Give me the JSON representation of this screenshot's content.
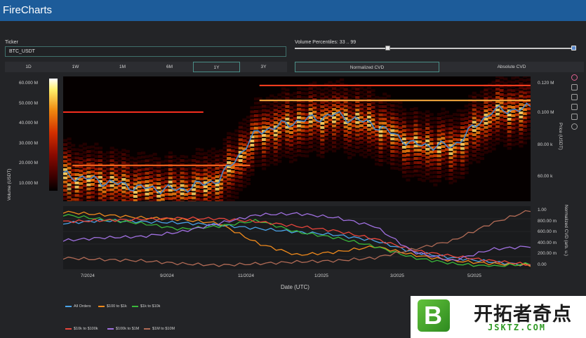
{
  "app": {
    "title": "FireCharts"
  },
  "ticker": {
    "label": "Ticker",
    "value": "BTC_USDT"
  },
  "volume_percentiles": {
    "label": "Volume Percentiles: 33 .. 99",
    "low": 33,
    "high": 99
  },
  "timeframes": {
    "items": [
      "1D",
      "1W",
      "1M",
      "6M",
      "1Y",
      "3Y"
    ],
    "active": "1Y"
  },
  "cvd_modes": {
    "items": [
      "Normalized CVD",
      "Absolute CVD"
    ],
    "active": "Normalized CVD"
  },
  "colors": {
    "topbar": "#1d5c9a",
    "accent_border": "#4a8d86",
    "price_line": "#4a86c8"
  },
  "heatmap": {
    "left_axis_title": "Volume (USDT)",
    "left_ticks": [
      "60.000 M",
      "50.000 M",
      "40.000 M",
      "30.000 M",
      "20.000 M",
      "10.000 M"
    ],
    "right_axis_title": "Price (USDT)",
    "right_ticks": [
      "0.120 M",
      "0.100 M",
      "80.00 k",
      "60.00 k"
    ]
  },
  "cvd": {
    "right_axis_title": "Normalized CVD (arb. u.)",
    "right_ticks": [
      "1.00",
      "800.00 m",
      "600.00 m",
      "400.00 m",
      "200.00 m",
      "0.00"
    ]
  },
  "x_axis": {
    "title": "Date (UTC)",
    "ticks": [
      "7/2024",
      "9/2024",
      "11/2024",
      "1/2025",
      "3/2025",
      "5/2025"
    ]
  },
  "chart_data": {
    "type": "line",
    "x_label": "Date (UTC)",
    "x": [
      "2024-06",
      "2024-07",
      "2024-08",
      "2024-09",
      "2024-10",
      "2024-11",
      "2024-12",
      "2025-01",
      "2025-02",
      "2025-03",
      "2025-04",
      "2025-05",
      "2025-06"
    ],
    "price_series": {
      "name": "Price (USDT)",
      "values": [
        66000,
        62000,
        58000,
        57000,
        63000,
        92000,
        98000,
        102000,
        96000,
        84000,
        83000,
        104000,
        106000
      ]
    },
    "cvd_series": [
      {
        "name": "All Orders",
        "color": "#4aa3e8",
        "values": [
          0.75,
          0.8,
          0.78,
          0.76,
          0.72,
          0.66,
          0.6,
          0.55,
          0.45,
          0.25,
          0.15,
          0.08,
          0.02
        ]
      },
      {
        "name": "$100 to $1k",
        "color": "#f08a1c",
        "values": [
          0.95,
          0.9,
          0.85,
          0.82,
          0.75,
          0.4,
          0.2,
          0.25,
          0.35,
          0.2,
          0.1,
          0.05,
          0.02
        ]
      },
      {
        "name": "$1k to $10k",
        "color": "#3ab83a",
        "values": [
          0.9,
          0.82,
          0.75,
          0.65,
          0.7,
          0.8,
          0.6,
          0.5,
          0.35,
          0.15,
          0.05,
          0.0,
          0.05
        ]
      },
      {
        "name": "$10k to $100k",
        "color": "#e8453c",
        "values": [
          0.78,
          0.8,
          0.82,
          0.84,
          0.83,
          0.78,
          0.7,
          0.62,
          0.48,
          0.28,
          0.18,
          0.1,
          0.03
        ]
      },
      {
        "name": "$100k to $1M",
        "color": "#a070e0",
        "values": [
          0.45,
          0.5,
          0.52,
          0.6,
          0.75,
          0.9,
          0.92,
          0.85,
          0.7,
          0.25,
          0.1,
          0.3,
          0.35
        ]
      },
      {
        "name": "$1M to $10M",
        "color": "#b06a55",
        "values": [
          0.15,
          0.12,
          0.1,
          0.05,
          0.02,
          0.05,
          0.08,
          0.1,
          0.15,
          0.3,
          0.45,
          0.75,
          0.98
        ]
      }
    ],
    "cvd_ylim": [
      0,
      1
    ],
    "price_ylim": [
      50000,
      125000
    ]
  }
}
